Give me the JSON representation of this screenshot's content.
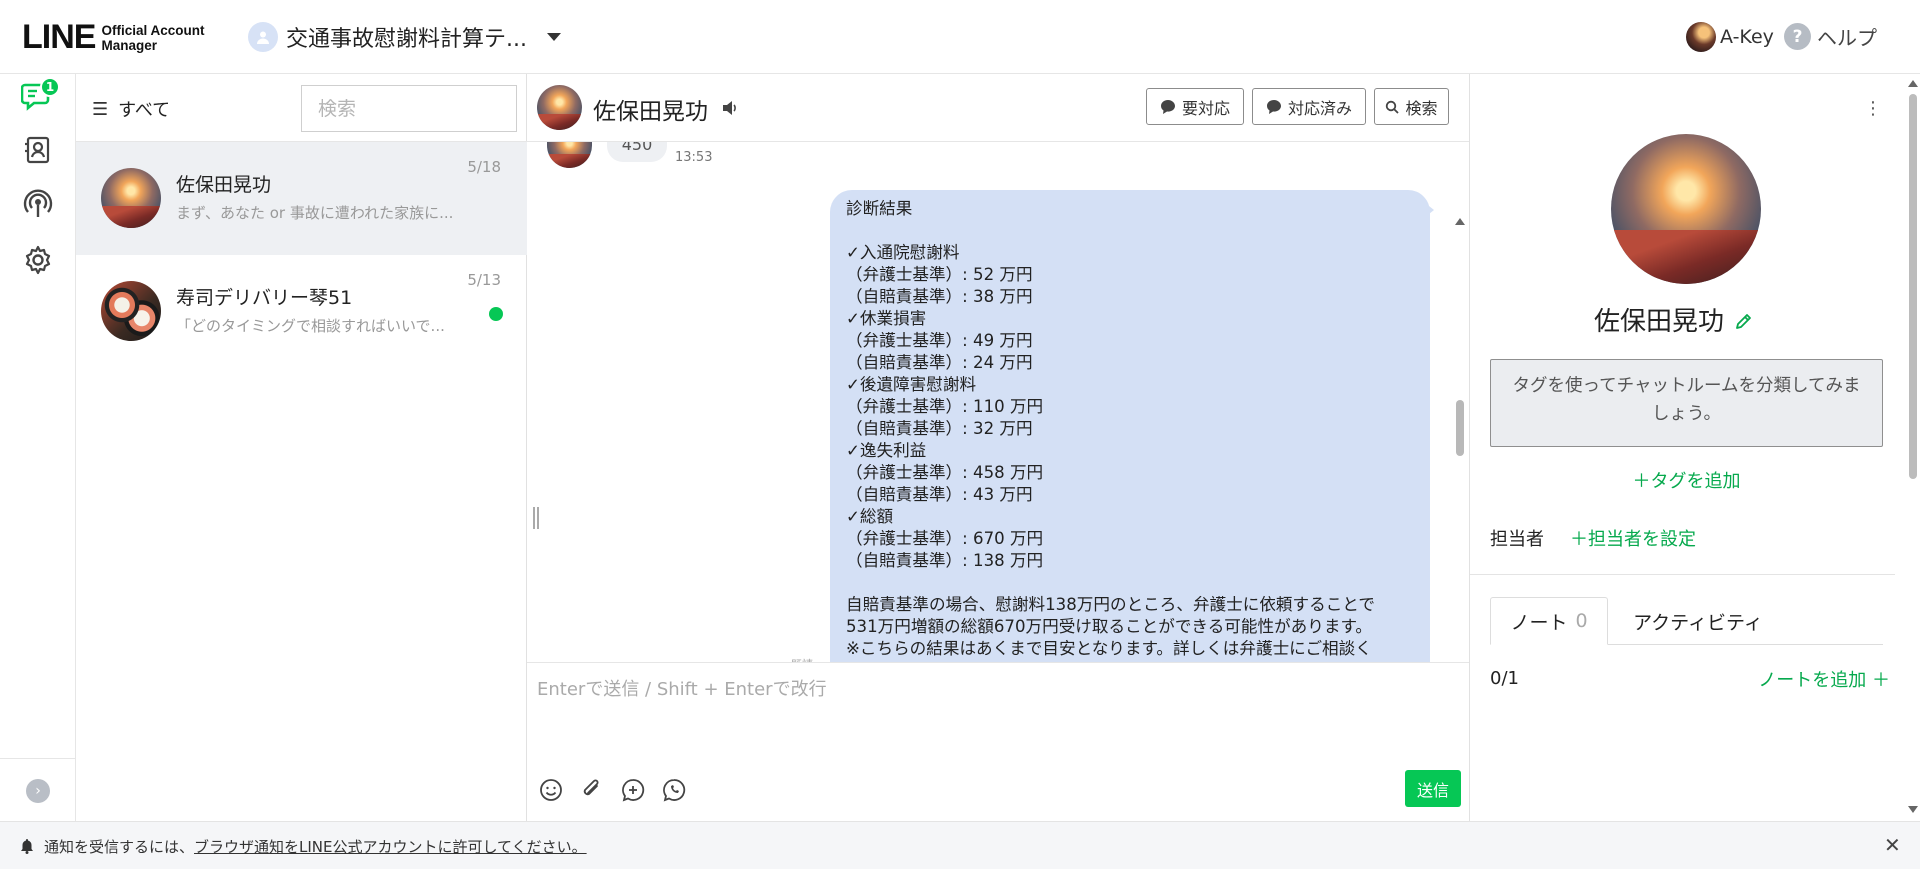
{
  "topbar": {
    "logo_main": "LINE",
    "logo_sub_1": "Official Account",
    "logo_sub_2": "Manager",
    "account_name": "交通事故慰謝料計算テ...",
    "user_name": "A-Key",
    "help_label": "ヘルプ"
  },
  "rail": {
    "unread_badge": "1"
  },
  "chat_list": {
    "filter_label": "すべて",
    "search_placeholder": "検索",
    "items": [
      {
        "name": "佐保田晃功",
        "preview": "まず、あなた or 事故に遭われた家族に...",
        "date": "5/18",
        "active": true
      },
      {
        "name": "寿司デリバリー琴51",
        "preview": "「どのタイミングで相談すればいいで...",
        "date": "5/13",
        "unread": true
      }
    ]
  },
  "chat": {
    "contact_name": "佐保田晃功",
    "buttons": {
      "needs_action": "要対応",
      "resolved": "対応済み",
      "search": "検索"
    },
    "incoming": {
      "text": "450",
      "time": "13:53"
    },
    "outgoing_text": "診断結果\n\n✓入通院慰謝料\n（弁護士基準）: 52 万円\n（自賠責基準）: 38 万円\n✓休業損害\n（弁護士基準）: 49 万円\n（自賠責基準）: 24 万円\n✓後遺障害慰謝料\n（弁護士基準）: 110 万円\n（自賠責基準）: 32 万円\n✓逸失利益\n（弁護士基準）: 458 万円\n（自賠責基準）: 43 万円\n✓総額\n（弁護士基準）: 670 万円\n（自賠責基準）: 138 万円\n\n自賠責基準の場合、慰謝料138万円のところ、弁護士に依頼することで\n531万円増額の総額670万円受け取ることができる可能性があります。\n※こちらの結果はあくまで目安となります。詳しくは弁護士にご相談く\nださい。",
    "read_mark": "既読",
    "composer_placeholder": "Enterで送信 / Shift + Enterで改行",
    "send_label": "送信"
  },
  "profile": {
    "name": "佐保田晃功",
    "tag_hint": "タグを使ってチャットルームを分類してみましょう。",
    "add_tag": "タグを追加",
    "assignee_label": "担当者",
    "assignee_set": "担当者を設定",
    "tab_note": "ノート",
    "tab_note_count": "0",
    "tab_activity": "アクティビティ",
    "note_count": "0/1",
    "add_note": "ノートを追加"
  },
  "notification": {
    "prefix": "通知を受信するには、",
    "link": "ブラウザ通知をLINE公式アカウントに許可してください。"
  },
  "colors": {
    "accent_green": "#06c755",
    "bubble_blue": "#d4e0f5"
  }
}
